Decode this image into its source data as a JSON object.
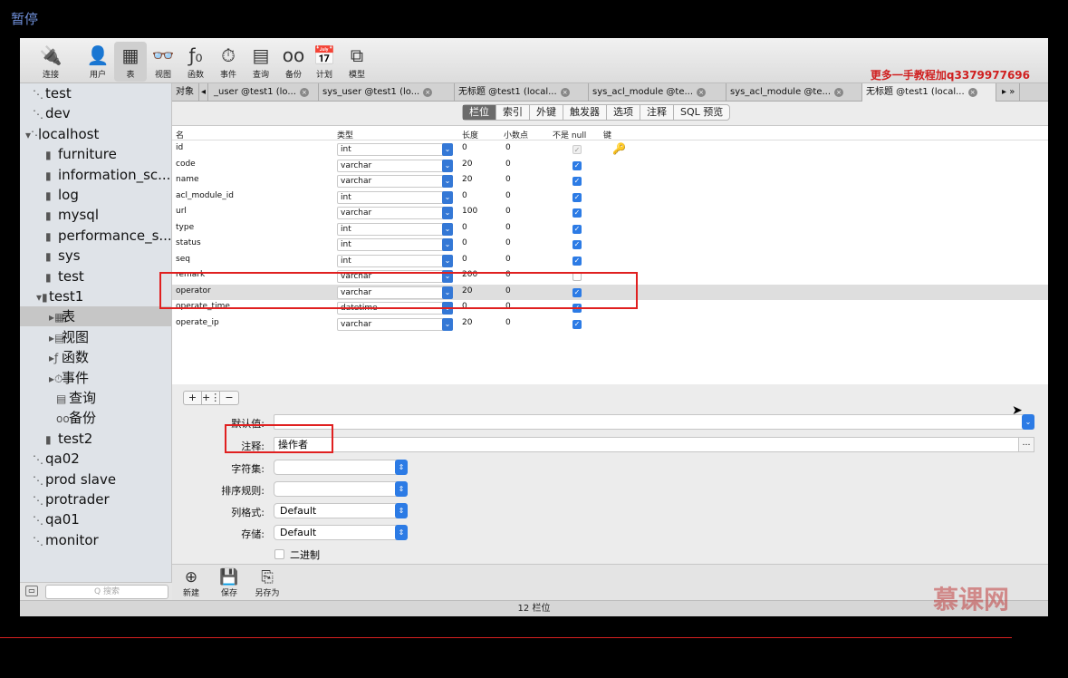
{
  "overlay": {
    "pause": "暂停",
    "watermark": "更多一手教程加q3379977696",
    "logo": "慕课网"
  },
  "toolbar": {
    "items": [
      {
        "label": "连接",
        "icon": "connect-icon",
        "glyph": "🔌"
      },
      {
        "label": "用户",
        "icon": "user-icon",
        "glyph": "👤"
      },
      {
        "label": "表",
        "icon": "table-icon",
        "glyph": "▦"
      },
      {
        "label": "视图",
        "icon": "view-icon",
        "glyph": "👓"
      },
      {
        "label": "函数",
        "icon": "function-icon",
        "glyph": "ƒ₀"
      },
      {
        "label": "事件",
        "icon": "event-icon",
        "glyph": "⏱"
      },
      {
        "label": "查询",
        "icon": "query-icon",
        "glyph": "▤"
      },
      {
        "label": "备份",
        "icon": "backup-icon",
        "glyph": "oo"
      },
      {
        "label": "计划",
        "icon": "schedule-icon",
        "glyph": "📅"
      },
      {
        "label": "模型",
        "icon": "model-icon",
        "glyph": "⧉"
      }
    ]
  },
  "sidebar": {
    "items": [
      {
        "label": "test",
        "glyph": "⋱"
      },
      {
        "label": "dev",
        "glyph": "⋱"
      },
      {
        "label": "localhost",
        "glyph": "▾⋱"
      },
      {
        "label": "furniture",
        "glyph": "▮"
      },
      {
        "label": "information_sc...",
        "glyph": "▮"
      },
      {
        "label": "log",
        "glyph": "▮"
      },
      {
        "label": "mysql",
        "glyph": "▮"
      },
      {
        "label": "performance_s...",
        "glyph": "▮"
      },
      {
        "label": "sys",
        "glyph": "▮"
      },
      {
        "label": "test",
        "glyph": "▮"
      },
      {
        "label": "test1",
        "glyph": "▾▮"
      },
      {
        "label": "表",
        "glyph": "▸▦"
      },
      {
        "label": "视图",
        "glyph": "▸▤"
      },
      {
        "label": "函数",
        "glyph": "▸ƒ"
      },
      {
        "label": "事件",
        "glyph": "▸⏱"
      },
      {
        "label": "查询",
        "glyph": "▤"
      },
      {
        "label": "备份",
        "glyph": "oo"
      },
      {
        "label": "test2",
        "glyph": "▮"
      },
      {
        "label": "qa02",
        "glyph": "⋱"
      },
      {
        "label": "prod slave",
        "glyph": "⋱"
      },
      {
        "label": "protrader",
        "glyph": "⋱"
      },
      {
        "label": "qa01",
        "glyph": "⋱"
      },
      {
        "label": "monitor",
        "glyph": "⋱"
      }
    ],
    "search_placeholder": "Q 搜索"
  },
  "tabs": {
    "object_label": "对象",
    "items": [
      {
        "label": "_user @test1 (lo..."
      },
      {
        "label": "sys_user @test1 (lo..."
      },
      {
        "label": "无标题 @test1 (local..."
      },
      {
        "label": "sys_acl_module @te..."
      },
      {
        "label": "sys_acl_module @te..."
      },
      {
        "label": "无标题 @test1 (local..."
      }
    ]
  },
  "subtabs": [
    "栏位",
    "索引",
    "外键",
    "触发器",
    "选项",
    "注释",
    "SQL 预览"
  ],
  "grid": {
    "headers": {
      "name": "名",
      "type": "类型",
      "length": "长度",
      "decimal": "小数点",
      "notnull": "不是 null",
      "key": "键"
    },
    "rows": [
      {
        "name": "id",
        "type": "int",
        "length": "0",
        "decimal": "0",
        "notnull": "dis",
        "key": true
      },
      {
        "name": "code",
        "type": "varchar",
        "length": "20",
        "decimal": "0",
        "notnull": "on"
      },
      {
        "name": "name",
        "type": "varchar",
        "length": "20",
        "decimal": "0",
        "notnull": "on"
      },
      {
        "name": "acl_module_id",
        "type": "int",
        "length": "0",
        "decimal": "0",
        "notnull": "on"
      },
      {
        "name": "url",
        "type": "varchar",
        "length": "100",
        "decimal": "0",
        "notnull": "on"
      },
      {
        "name": "type",
        "type": "int",
        "length": "0",
        "decimal": "0",
        "notnull": "on"
      },
      {
        "name": "status",
        "type": "int",
        "length": "0",
        "decimal": "0",
        "notnull": "on"
      },
      {
        "name": "seq",
        "type": "int",
        "length": "0",
        "decimal": "0",
        "notnull": "on"
      },
      {
        "name": "remark",
        "type": "varchar",
        "length": "200",
        "decimal": "0",
        "notnull": "off"
      },
      {
        "name": "operator",
        "type": "varchar",
        "length": "20",
        "decimal": "0",
        "notnull": "on",
        "selected": true
      },
      {
        "name": "operate_time",
        "type": "datetime",
        "length": "0",
        "decimal": "0",
        "notnull": "on"
      },
      {
        "name": "operate_ip",
        "type": "varchar",
        "length": "20",
        "decimal": "0",
        "notnull": "on"
      }
    ]
  },
  "editbar": {
    "add": "+",
    "insert": "+⋮",
    "remove": "−"
  },
  "props": {
    "default_label": "默认值:",
    "default_value": "",
    "comment_label": "注释:",
    "comment_value": "操作者",
    "charset_label": "字符集:",
    "charset_value": "",
    "collation_label": "排序规则:",
    "collation_value": "",
    "colformat_label": "列格式:",
    "colformat_value": "Default",
    "storage_label": "存储:",
    "storage_value": "Default",
    "binary_label": "二进制"
  },
  "bottombar": {
    "new": "新建",
    "save": "保存",
    "saveas": "另存为"
  },
  "status": {
    "text": "12 栏位"
  }
}
